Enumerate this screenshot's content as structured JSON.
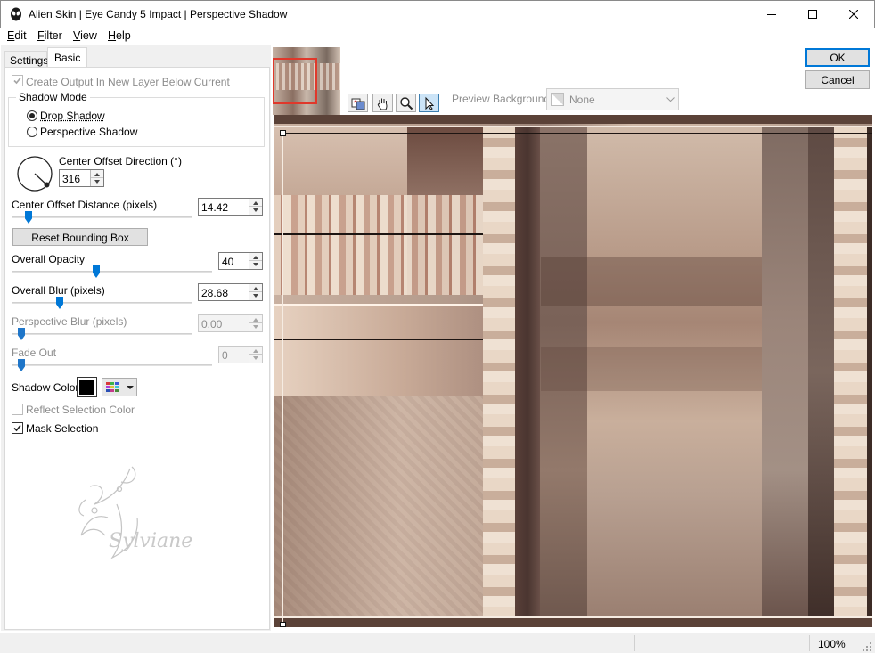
{
  "window": {
    "title": "Alien Skin | Eye Candy 5 Impact | Perspective Shadow",
    "minimize_icon": "minimize-icon",
    "maximize_icon": "maximize-icon",
    "close_icon": "close-icon"
  },
  "menu": [
    {
      "label": "Edit",
      "accel": "E",
      "rest": "dit"
    },
    {
      "label": "Filter",
      "accel": "F",
      "rest": "ilter"
    },
    {
      "label": "View",
      "accel": "V",
      "rest": "iew"
    },
    {
      "label": "Help",
      "accel": "H",
      "rest": "elp"
    }
  ],
  "tabs": {
    "settings": "Settings",
    "basic": "Basic",
    "active": "Basic"
  },
  "basic": {
    "create_output_label": "Create Output In New Layer Below Current",
    "create_output_checked": true,
    "create_output_enabled": false,
    "shadow_mode": {
      "legend": "Shadow Mode",
      "options": [
        "Drop Shadow",
        "Perspective Shadow"
      ],
      "selected": "Drop Shadow"
    },
    "center_offset_direction": {
      "label": "Center Offset Direction (°)",
      "value": "316"
    },
    "center_offset_distance": {
      "label": "Center Offset Distance (pixels)",
      "value": "14.42"
    },
    "reset_button": "Reset Bounding Box",
    "overall_opacity": {
      "label": "Overall Opacity",
      "value": "40"
    },
    "overall_blur": {
      "label": "Overall Blur (pixels)",
      "value": "28.68"
    },
    "perspective_blur": {
      "label": "Perspective Blur (pixels)",
      "value": "0.00",
      "enabled": false
    },
    "fade_out": {
      "label": "Fade Out",
      "value": "0",
      "enabled": false
    },
    "shadow_color": {
      "label": "Shadow Color",
      "color": "#000000"
    },
    "reflect_selection": {
      "label": "Reflect Selection Color",
      "checked": false,
      "enabled": false
    },
    "mask_selection": {
      "label": "Mask Selection",
      "checked": true
    },
    "watermark": "Sylviane"
  },
  "buttons": {
    "ok": "OK",
    "cancel": "Cancel"
  },
  "preview_background": {
    "label": "Preview Background:",
    "value": "None"
  },
  "toolbar_icons": [
    "preview-toggle-icon",
    "hand-pan-icon",
    "zoom-icon",
    "pointer-arrow-icon"
  ],
  "status": {
    "zoom": "100%"
  },
  "colors": {
    "accent": "#0078d7",
    "panel": "#f0f0f0",
    "shadow_color": "#000000"
  }
}
